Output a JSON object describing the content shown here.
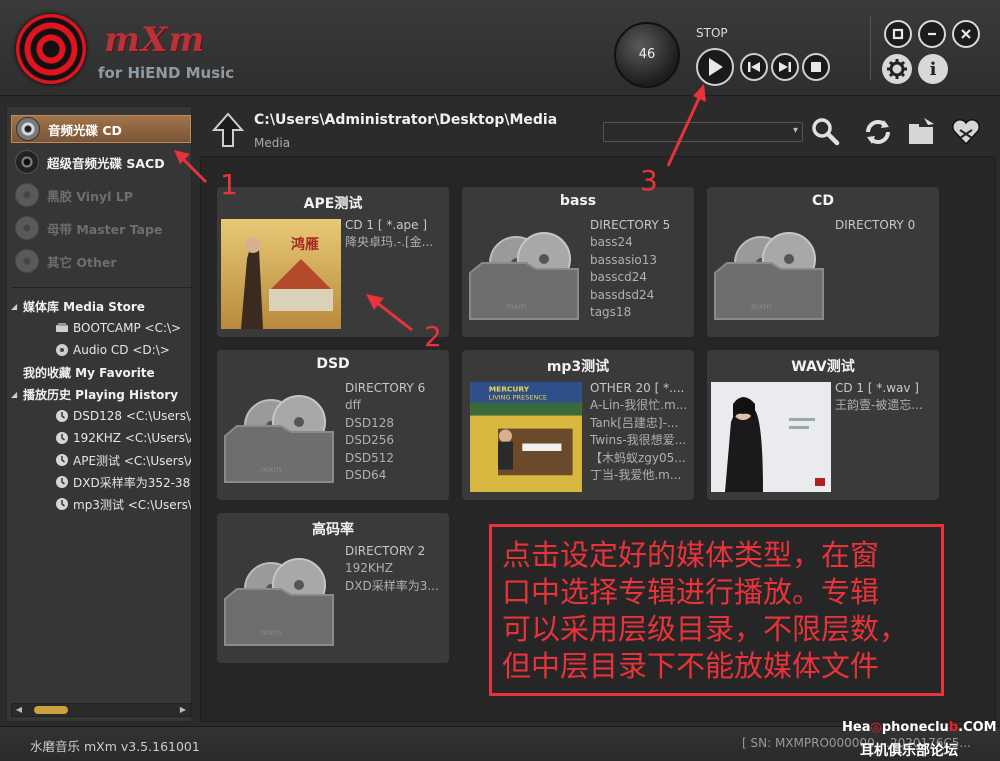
{
  "app": {
    "name": "mXm",
    "subtitle": "for HiEND Music"
  },
  "player": {
    "volume": "46",
    "state": "STOP"
  },
  "media_types": [
    {
      "label": "音频光碟 CD",
      "state": "active"
    },
    {
      "label": "超级音频光碟 SACD",
      "state": "bright"
    },
    {
      "label": "黑胶 Vinyl LP",
      "state": "dim"
    },
    {
      "label": "母带 Master Tape",
      "state": "dim"
    },
    {
      "label": "其它 Other",
      "state": "dim"
    }
  ],
  "tree": {
    "media_store": "媒体库  Media Store",
    "media_store_items": [
      "BOOTCAMP <C:\\>",
      "Audio CD <D:\\>"
    ],
    "favorite": "我的收藏  My Favorite",
    "history": "播放历史 Playing History",
    "history_items": [
      "DSD128 <C:\\Users\\A",
      "192KHZ <C:\\Users\\A",
      "APE测试 <C:\\Users\\A",
      "DXD采样率为352-38",
      "mp3测试 <C:\\Users\\"
    ]
  },
  "path": {
    "current": "C:\\Users\\Administrator\\Desktop\\Media",
    "sub": "Media",
    "combo_value": ""
  },
  "cards": [
    {
      "title": "APE测试",
      "info": [
        "CD  1 [ *.ape ]",
        "降央卓玛.-.[金..."
      ],
      "thumb": "album-cover"
    },
    {
      "title": "bass",
      "info": [
        "DIRECTORY  5",
        "bass24",
        "bassasio13",
        "basscd24",
        "bassdsd24",
        "tags18"
      ],
      "thumb": "folder-icon"
    },
    {
      "title": "CD",
      "info": [
        "DIRECTORY  0"
      ],
      "thumb": "folder-icon"
    },
    {
      "title": "DSD",
      "info": [
        "DIRECTORY  6",
        "dff",
        "DSD128",
        "DSD256",
        "DSD512",
        "DSD64"
      ],
      "thumb": "folder-icon"
    },
    {
      "title": "mp3测试",
      "info": [
        "OTHER  20 [ *....",
        "A-Lin-我很忙.m...",
        "Tank[吕建忠]-...",
        "Twins-我很想爱...",
        "【木蚂蚁zgy05...",
        "丁当-我爱他.m..."
      ],
      "thumb": "album-cover"
    },
    {
      "title": "WAV测试",
      "info": [
        "CD  1 [ *.wav ]",
        "王韵壹-被遗忘..."
      ],
      "thumb": "album-cover"
    },
    {
      "title": "高码率",
      "info": [
        "DIRECTORY  2",
        "192KHZ",
        "DXD采样率为3..."
      ],
      "thumb": "folder-icon"
    }
  ],
  "annotation": {
    "lines": [
      "点击设定好的媒体类型，在窗",
      "口中选择专辑进行播放。专辑",
      "可以采用层级目录，不限层数，",
      "但中层目录下不能放媒体文件"
    ],
    "numbers": [
      "1",
      "2",
      "3"
    ],
    "color": "#e8333a"
  },
  "status": {
    "version": "水磨音乐 mXm v3.5.161001",
    "serial": "[ SN: MXMPRO000000....2020176C5..."
  },
  "watermark": {
    "top_a": "Hea",
    "top_b": "phoneclu",
    "top_c": ".COM",
    "bottom": "耳机俱乐部论坛"
  },
  "colors": {
    "accent_active": "#a0744c",
    "logo_red": "#e0141e",
    "scroll_thumb": "#c9a13f"
  }
}
